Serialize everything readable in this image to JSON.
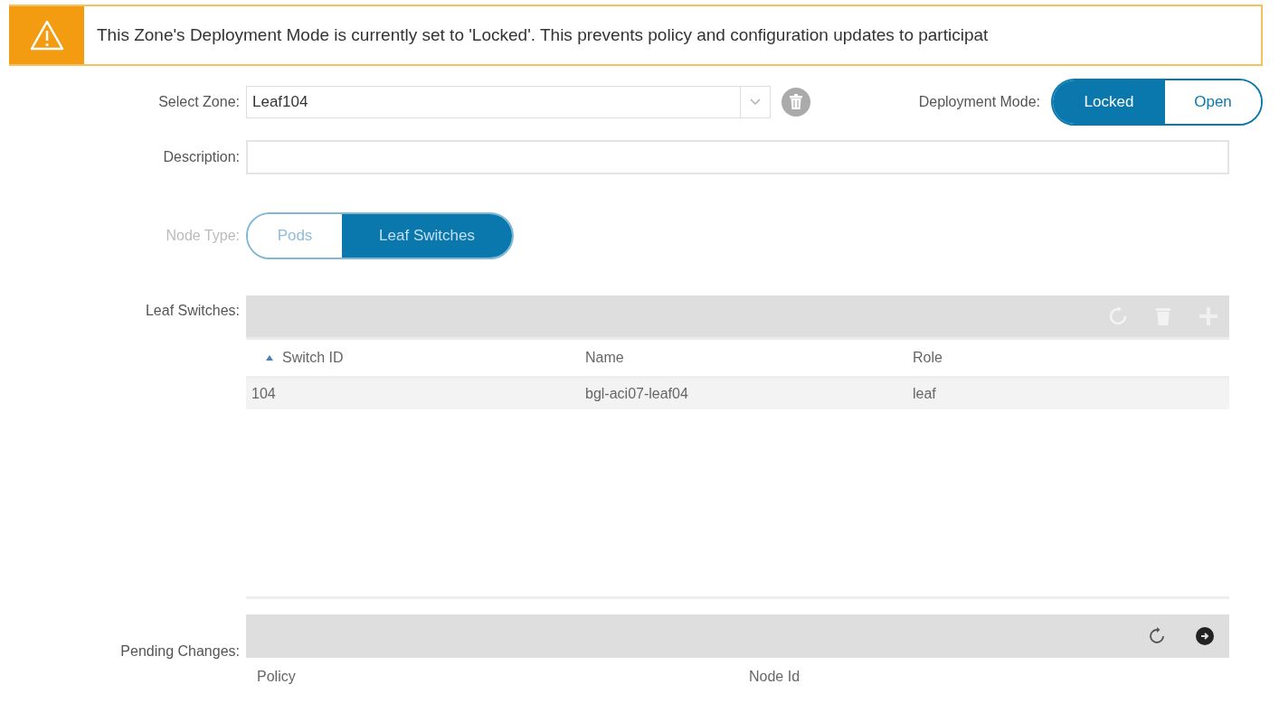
{
  "banner": {
    "text": "This Zone's Deployment Mode is currently set to 'Locked'. This prevents policy and configuration updates to participat"
  },
  "zone": {
    "label": "Select Zone:",
    "value": "Leaf104"
  },
  "deployment_mode": {
    "label": "Deployment Mode:",
    "options": [
      {
        "label": "Locked",
        "selected": true
      },
      {
        "label": "Open",
        "selected": false
      }
    ]
  },
  "description": {
    "label": "Description:"
  },
  "node_type": {
    "label": "Node Type:",
    "disabled": true,
    "options": [
      {
        "label": "Pods",
        "selected": false
      },
      {
        "label": "Leaf Switches",
        "selected": true
      }
    ]
  },
  "leaf_switches": {
    "label": "Leaf Switches:",
    "columns": [
      {
        "label": "Switch ID",
        "sorted": true
      },
      {
        "label": "Name",
        "sorted": false
      },
      {
        "label": "Role",
        "sorted": false
      }
    ],
    "rows": [
      [
        "104",
        "bgl-aci07-leaf04",
        "leaf"
      ]
    ]
  },
  "pending_changes": {
    "label": "Pending Changes:",
    "columns": [
      "Policy",
      "Node Id"
    ]
  }
}
